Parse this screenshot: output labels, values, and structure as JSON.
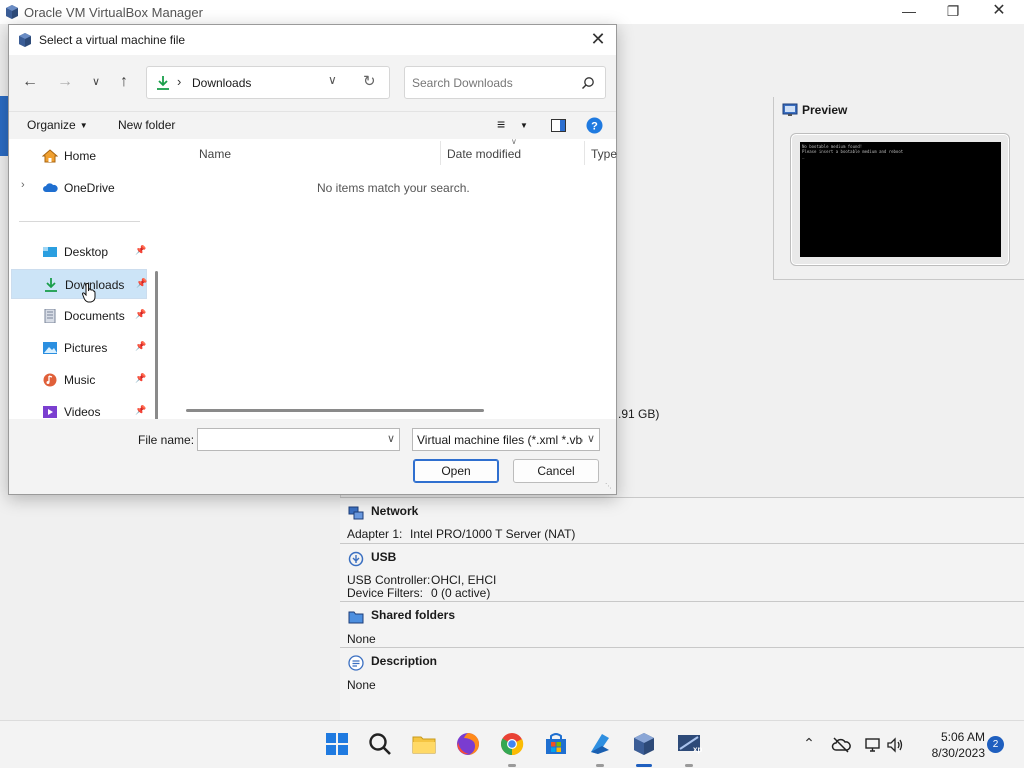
{
  "vbox": {
    "title": "Oracle VM VirtualBox Manager",
    "preview_title": "Preview",
    "preview_lines": [
      "No bootable medium found!",
      "Please insert a bootable medium and reboot",
      "_"
    ],
    "size_fragment": ".91 GB)",
    "network": {
      "title": "Network",
      "adapter_key": "Adapter 1:",
      "adapter_val": "Intel PRO/1000 T Server (NAT)"
    },
    "usb": {
      "title": "USB",
      "controller_key": "USB Controller:",
      "controller_val": "OHCI, EHCI",
      "filters_key": "Device Filters:",
      "filters_val": "0 (0 active)"
    },
    "shared": {
      "title": "Shared folders",
      "value": "None"
    },
    "description": {
      "title": "Description",
      "value": "None"
    }
  },
  "dialog": {
    "title": "Select a virtual machine file",
    "address": {
      "crumb": "Downloads"
    },
    "search": {
      "placeholder": "Search Downloads"
    },
    "toolbar": {
      "organize": "Organize",
      "new_folder": "New folder"
    },
    "nav": {
      "home": "Home",
      "onedrive": "OneDrive",
      "desktop": "Desktop",
      "downloads": "Downloads",
      "documents": "Documents",
      "pictures": "Pictures",
      "music": "Music",
      "videos": "Videos"
    },
    "columns": {
      "name": "Name",
      "date": "Date modified",
      "type": "Type"
    },
    "empty_message": "No items match your search.",
    "file_name_label": "File name:",
    "file_name_value": "",
    "file_type": "Virtual machine files (*.xml *.vbox)",
    "open": "Open",
    "cancel": "Cancel"
  },
  "taskbar": {
    "time": "5:06 AM",
    "date": "8/30/2023",
    "notifications": "2"
  },
  "colors": {
    "accent": "#1f5fbf",
    "selection": "#cce4f7"
  }
}
